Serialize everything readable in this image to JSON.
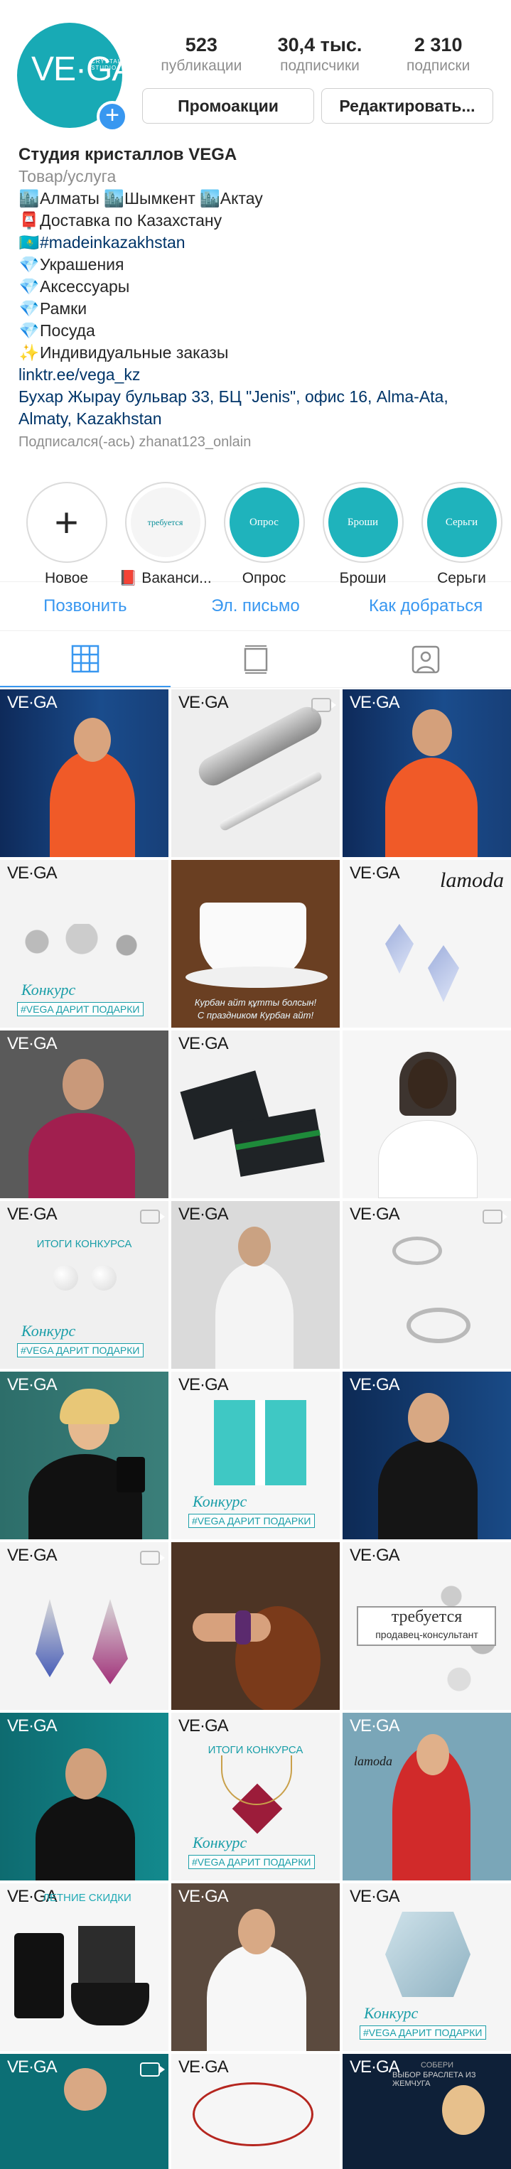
{
  "profile": {
    "avatar_logo": "VE·GA",
    "avatar_logo_sub": "CRYSTAL STUDIO",
    "stats": [
      {
        "value": "523",
        "label": "публикации"
      },
      {
        "value": "30,4 тыс.",
        "label": "подписчики"
      },
      {
        "value": "2 310",
        "label": "подписки"
      }
    ],
    "promo_button": "Промоакции",
    "edit_button": "Редактировать..."
  },
  "bio": {
    "name": "Студия кристаллов VEGA",
    "category": "Товар/услуга",
    "lines": [
      {
        "emoji": "🏙️",
        "text": "Алматы 🏙️Шымкент 🏙️Актау"
      },
      {
        "emoji": "📮",
        "text": "Доставка по Казахстану"
      },
      {
        "emoji": "🇰🇿",
        "text": "#madeinkazakhstan"
      },
      {
        "emoji": "💎",
        "text": "Украшения"
      },
      {
        "emoji": "💎",
        "text": "Аксессуары"
      },
      {
        "emoji": "💎",
        "text": "Рамки"
      },
      {
        "emoji": "💎",
        "text": "Посуда"
      },
      {
        "emoji": "✨",
        "text": "Индивидуальные заказы"
      }
    ],
    "link": "linktr.ee/vega_kz",
    "address": "Бухар Жырау бульвар 33, БЦ \"Jenis\", офис 16, Alma-Ata, Almaty, Kazakhstan",
    "followed_by": "Подписался(-ась) zhanat123_onlain"
  },
  "highlights": [
    {
      "label": "Новое",
      "inner": "+"
    },
    {
      "label": "📕 Ваканси...",
      "inner": "требуется"
    },
    {
      "label": "Опрос",
      "inner": "Опрос"
    },
    {
      "label": "Броши",
      "inner": "Броши"
    },
    {
      "label": "Серьги",
      "inner": "Серьги"
    }
  ],
  "contacts": [
    "Позвонить",
    "Эл. письмо",
    "Как добраться"
  ],
  "tabs": [
    "grid-icon",
    "feed-icon",
    "tagged-icon"
  ],
  "posts": {
    "logo": "VE·GA",
    "kontest": "Конкурс",
    "vega_gifts": "#VEGA ДАРИТ ПОДАРКИ",
    "itogi": "ИТОГИ КОНКУРСА",
    "lamoda": "lamoda",
    "kurban_1": "Курбан айт құтты болсын!",
    "kurban_2": "С праздником Курбан айт!",
    "trebuetsya": "требуется",
    "prodavec": "продавец-консультант",
    "summer_sale": "ЛЕТНИЕ СКИДКИ",
    "bracelet_1": "СОБЕРИ",
    "bracelet_2": "ВЫБОР БРАСЛЕТА ИЗ ЖЕМЧУГА"
  },
  "colors": {
    "brand_teal": "#18aab5",
    "link_blue": "#3897f0",
    "text": "#262626",
    "muted": "#8e8e8e"
  }
}
